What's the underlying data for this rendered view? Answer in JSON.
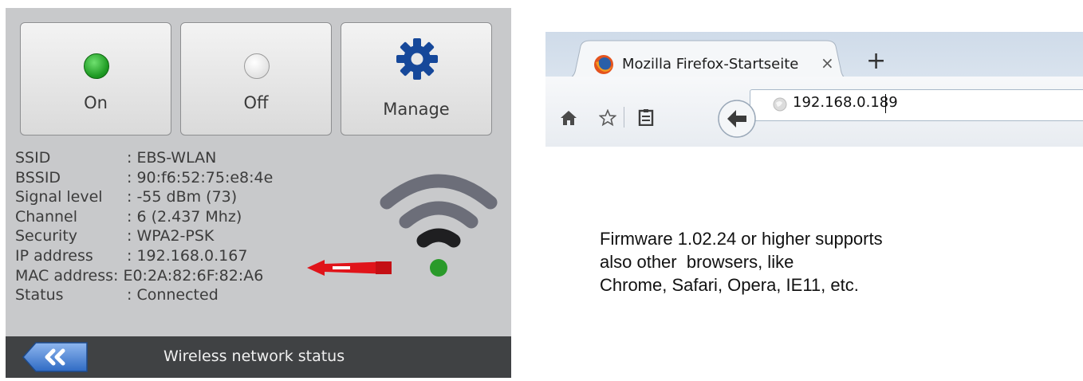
{
  "device": {
    "buttons": {
      "on": "On",
      "off": "Off",
      "manage": "Manage"
    },
    "info": [
      {
        "key": "SSID",
        "value": ": EBS-WLAN"
      },
      {
        "key": "BSSID",
        "value": ": 90:f6:52:75:e8:4e"
      },
      {
        "key": "Signal level",
        "value": ": -55 dBm (73)"
      },
      {
        "key": "Channel",
        "value": ": 6 (2.437 Mhz)"
      },
      {
        "key": "Security",
        "value": ": WPA2-PSK"
      },
      {
        "key": "IP address",
        "value": ": 192.168.0.167"
      },
      {
        "key": "MAC address",
        "value": ": E0:2A:82:6F:82:A6"
      },
      {
        "key": "Status",
        "value": ": Connected"
      }
    ],
    "status_bar": {
      "title": "Wireless network status"
    },
    "colors": {
      "led_on": "#22a326",
      "arrow": "#e0141a",
      "wifi_dot": "#2a9a2a"
    },
    "icons": {
      "manage": "gear-icon",
      "back": "double-chevron-left-icon",
      "signal": "wifi-icon"
    }
  },
  "browser": {
    "tab_title": "Mozilla Firefox-Startseite",
    "tab_close": "×",
    "new_tab": "+",
    "url": "192.168.0.189"
  },
  "note": {
    "lines": [
      "Firmware 1.02.24 or higher supports",
      "also other  browsers, like",
      "Chrome, Safari, Opera, IE11, etc."
    ]
  }
}
